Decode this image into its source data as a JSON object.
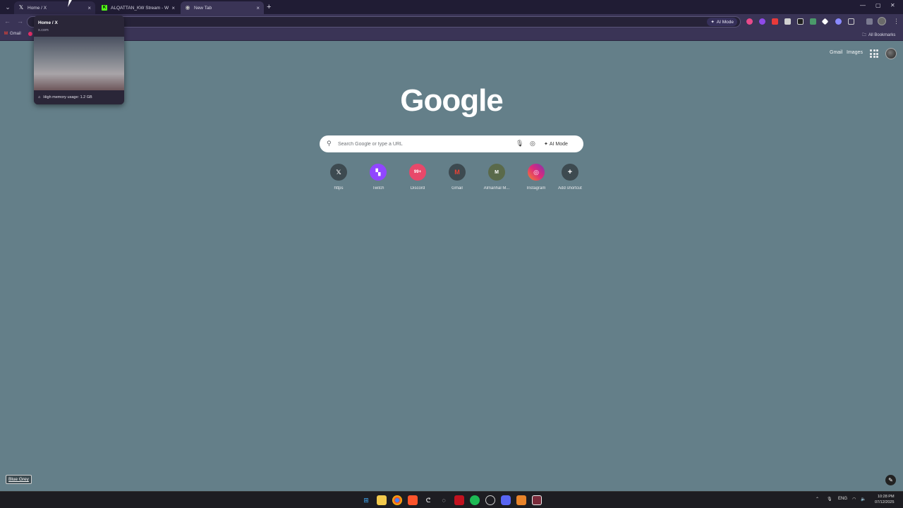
{
  "browser": {
    "tabs": [
      {
        "title": "Home / X",
        "favicon": "x-logo-icon",
        "state": "hover"
      },
      {
        "title": "ALQATTAN_KW Stream - Watc",
        "favicon": "kick-logo-icon",
        "state": "inactive"
      },
      {
        "title": "New Tab",
        "favicon": "chrome-newtab-icon",
        "state": "active"
      }
    ],
    "new_tab_symbol": "+",
    "close_symbol": "×",
    "omnibox_ai_mode": "AI Mode",
    "bookmarks": [
      {
        "label": "Gmail",
        "icon": "gmail-icon"
      }
    ],
    "all_bookmarks": "All Bookmarks",
    "hover_card": {
      "title": "Home / X",
      "domain": "x.com",
      "memory": "High memory usage: 1.2 GB"
    }
  },
  "ntp": {
    "links": {
      "gmail": "Gmail",
      "images": "Images"
    },
    "logo": "Google",
    "search_placeholder": "Search Google or type a URL",
    "ai_mode": "AI Mode",
    "shortcuts": [
      {
        "label": "https",
        "glyph": "𝕏",
        "icon": "x-shortcut-icon"
      },
      {
        "label": "Twitch",
        "glyph": "▚",
        "icon": "twitch-shortcut-icon"
      },
      {
        "label": "Discord",
        "glyph": "99+",
        "icon": "discord-shortcut-icon"
      },
      {
        "label": "Gmail",
        "glyph": "M",
        "icon": "gmail-shortcut-icon"
      },
      {
        "label": "Almanhal M...",
        "glyph": "M",
        "icon": "almanhal-shortcut-icon"
      },
      {
        "label": "Instagram",
        "glyph": "◎",
        "icon": "instagram-shortcut-icon"
      },
      {
        "label": "Add shortcut",
        "glyph": "+",
        "icon": "add-shortcut-icon"
      }
    ],
    "theme_name": "Blue Grey"
  },
  "taskbar": {
    "language": "ENG",
    "time": "10:28 PM",
    "date": "07/12/2025"
  },
  "colors": {
    "ntp_background": "#647f89",
    "tabstrip": "#201c34",
    "toolbar": "#3a3456",
    "taskbar": "#1d1d22"
  }
}
